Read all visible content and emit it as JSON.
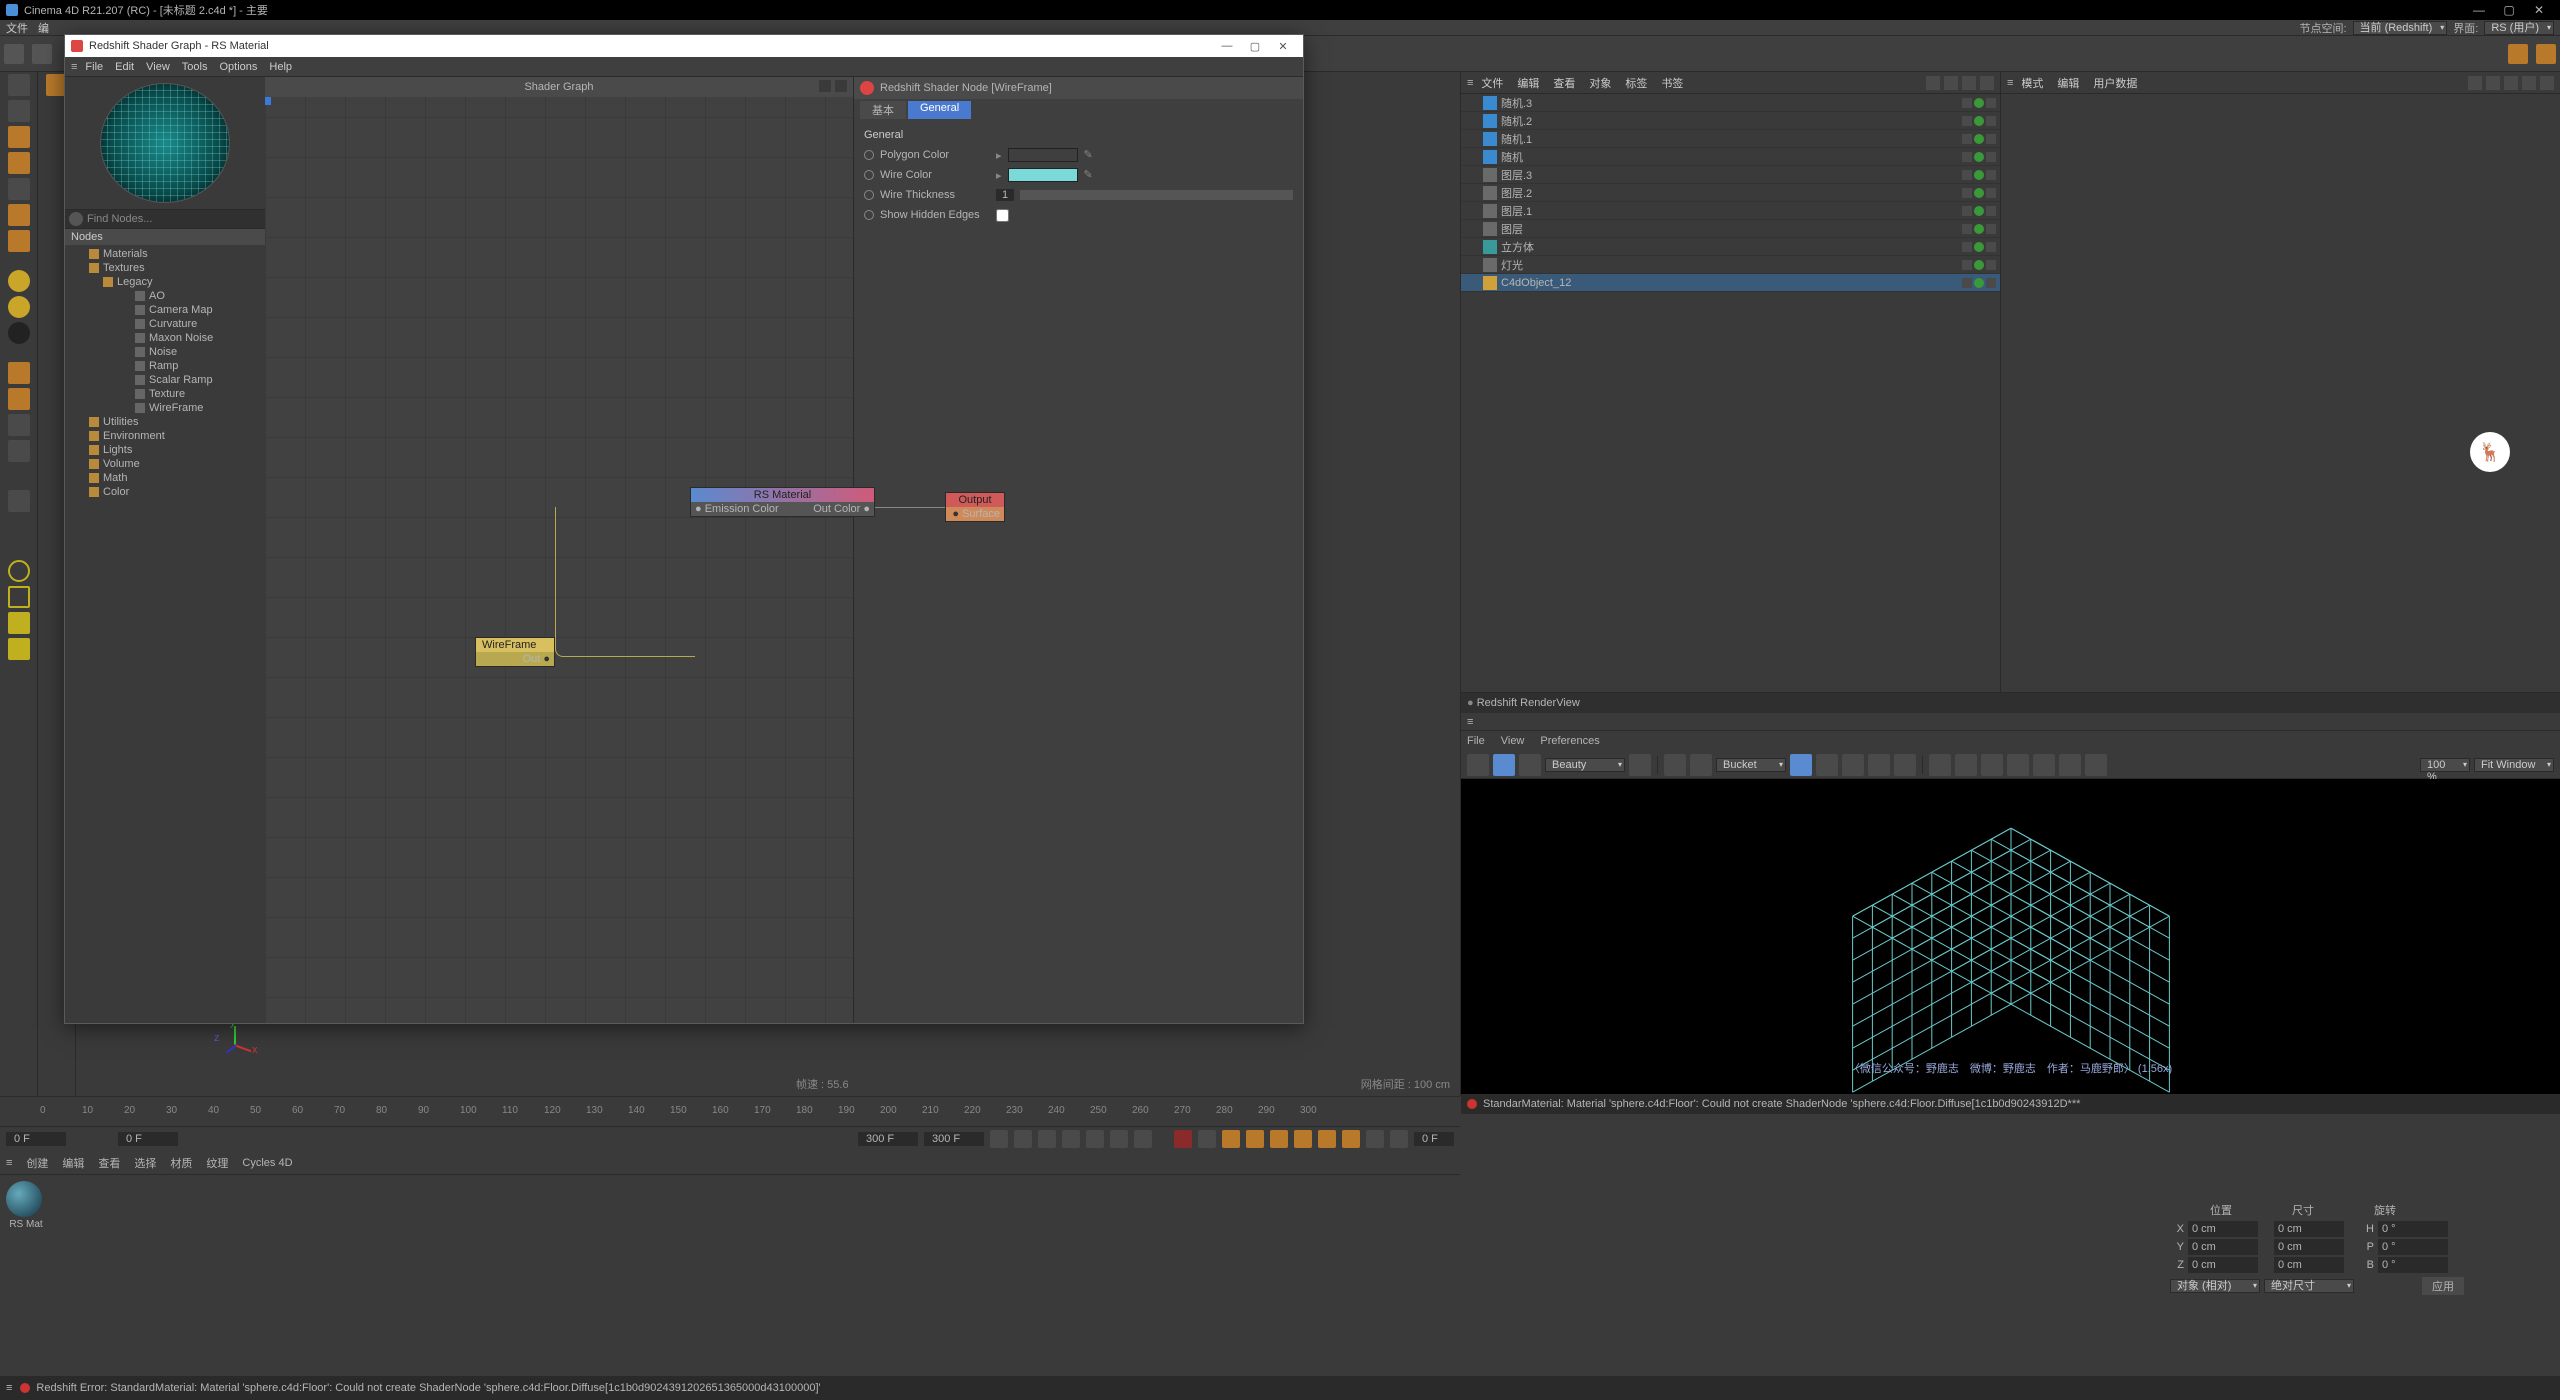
{
  "app": {
    "title": "Cinema 4D R21.207 (RC) - [未标题 2.c4d *] - 主要",
    "node_space_label": "节点空间:",
    "node_space_value": "当前 (Redshift)",
    "layout_label": "界面:",
    "layout_value": "RS (用户)"
  },
  "topmenu": [
    "文件",
    "编"
  ],
  "shader_window": {
    "title": "Redshift Shader Graph - RS Material",
    "menu": [
      "File",
      "Edit",
      "View",
      "Tools",
      "Options",
      "Help"
    ],
    "graph_header": "Shader Graph",
    "find_placeholder": "Find Nodes...",
    "list_header": "Nodes",
    "tree": {
      "materials": "Materials",
      "textures": "Textures",
      "legacy": "Legacy",
      "items": [
        "AO",
        "Camera Map",
        "Curvature",
        "Maxon Noise",
        "Noise",
        "Ramp",
        "Scalar Ramp",
        "Texture",
        "WireFrame"
      ],
      "utilities": "Utilities",
      "environment": "Environment",
      "lights": "Lights",
      "volume": "Volume",
      "math": "Math",
      "color": "Color"
    },
    "nodes": {
      "wireframe": {
        "title": "WireFrame",
        "out": "Out"
      },
      "rsmat": {
        "title": "RS Material",
        "in": "Emission Color",
        "out": "Out Color"
      },
      "output": {
        "title": "Output",
        "surface": "Surface"
      }
    },
    "props": {
      "header": "Redshift Shader Node [WireFrame]",
      "tab_basic": "基本",
      "tab_general": "General",
      "section": "General",
      "polygon_color": "Polygon Color",
      "wire_color": "Wire Color",
      "wire_thickness": "Wire Thickness",
      "wire_thickness_val": "1",
      "show_hidden": "Show Hidden Edges",
      "poly_color_val": "#000000",
      "wire_color_val": "#7adada"
    }
  },
  "viewport": {
    "fps_label": "帧速 : 55.6",
    "grid_label": "网格间距 : 100 cm"
  },
  "objmgr": {
    "menu": [
      "文件",
      "编辑",
      "查看",
      "对象",
      "标签",
      "书签"
    ],
    "items": [
      {
        "name": "随机.3",
        "icon": "cam"
      },
      {
        "name": "随机.2",
        "icon": "cam"
      },
      {
        "name": "随机.1",
        "icon": "cam"
      },
      {
        "name": "随机",
        "icon": "cam"
      },
      {
        "name": "图层.3",
        "icon": "def"
      },
      {
        "name": "图层.2",
        "icon": "def"
      },
      {
        "name": "图层.1",
        "icon": "def"
      },
      {
        "name": "图层",
        "icon": "def"
      },
      {
        "name": "立方体",
        "icon": "cube"
      },
      {
        "name": "灯光",
        "icon": "def"
      },
      {
        "name": "C4dObject_12",
        "icon": "flr",
        "sel": true
      }
    ]
  },
  "attr": {
    "menu": [
      "模式",
      "编辑",
      "用户数据"
    ]
  },
  "renderview": {
    "title": "Redshift RenderView",
    "menu": [
      "File",
      "View",
      "Preferences"
    ],
    "aov": "Beauty",
    "bucket": "Bucket",
    "zoom": "100 %",
    "fit": "Fit Window",
    "caption": "〈微信公众号：野鹿志　微博：野鹿志　作者：马鹿野郎〉  (1.56x)",
    "error": "StandarMaterial: Material 'sphere.c4d:Floor': Could not create ShaderNode 'sphere.c4d:Floor.Diffuse[1c1b0d90243912D***"
  },
  "timeline": {
    "ticks": [
      "0",
      "10",
      "20",
      "30",
      "40",
      "50",
      "60",
      "70",
      "80",
      "90",
      "100",
      "110",
      "120",
      "130",
      "140",
      "150",
      "160",
      "170",
      "180",
      "190",
      "200",
      "210",
      "220",
      "230",
      "240",
      "250",
      "260",
      "270",
      "280",
      "290",
      "300"
    ],
    "cur": "0 F",
    "start": "0 F",
    "end": "300 F",
    "end2": "300 F",
    "end_right": "0 F"
  },
  "matbar": {
    "menu": [
      "创建",
      "编辑",
      "查看",
      "选择",
      "材质",
      "纹理",
      "Cycles 4D"
    ],
    "slot": "RS Mat"
  },
  "coords": {
    "hdr": [
      "位置",
      "尺寸",
      "旋转"
    ],
    "rows": [
      {
        "a": "X",
        "v1": "0 cm",
        "v2": "0 cm",
        "a2": "H",
        "v3": "0 °"
      },
      {
        "a": "Y",
        "v1": "0 cm",
        "v2": "0 cm",
        "a2": "P",
        "v3": "0 °"
      },
      {
        "a": "Z",
        "v1": "0 cm",
        "v2": "0 cm",
        "a2": "B",
        "v3": "0 °"
      }
    ],
    "mode1": "对象 (相对)",
    "mode2": "绝对尺寸",
    "apply": "应用"
  },
  "status": {
    "error": "Redshift Error: StandardMaterial: Material 'sphere.c4d:Floor': Could not create ShaderNode 'sphere.c4d:Floor.Diffuse[1c1b0d9024391202651365000d43100000]'"
  }
}
